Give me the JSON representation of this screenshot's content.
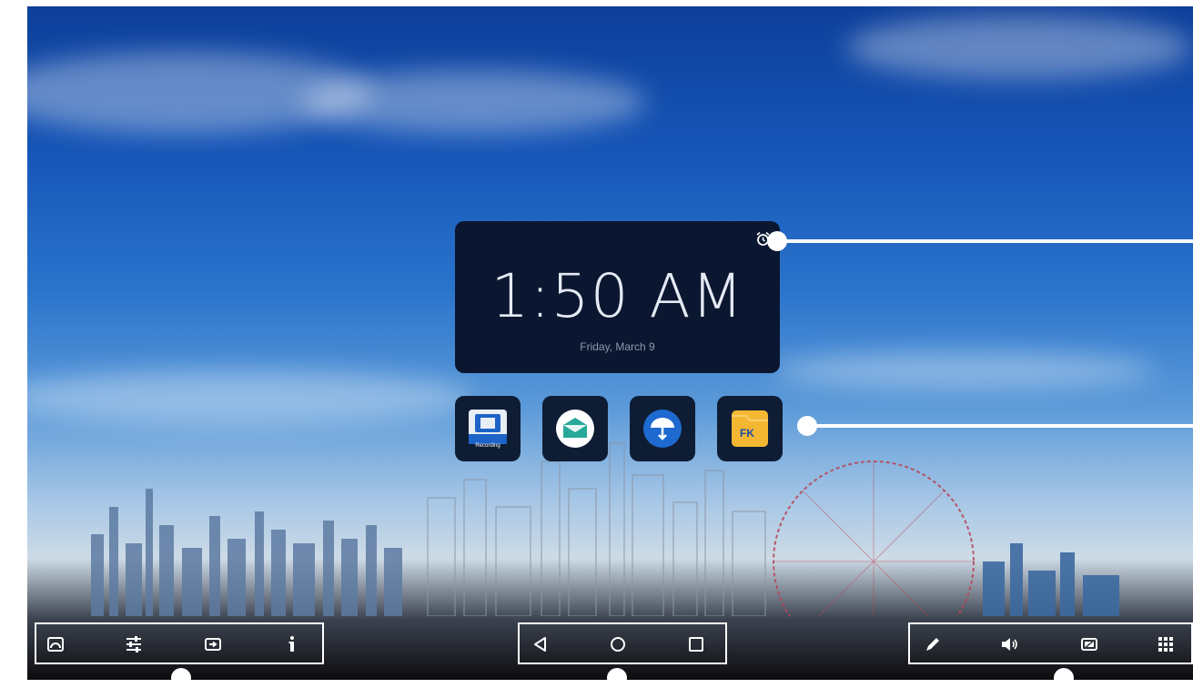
{
  "clock": {
    "time": "1:50 AM",
    "date": "Friday, March 9"
  },
  "apps": [
    {
      "name": "recording",
      "label": "Recording"
    },
    {
      "name": "mail",
      "label": ""
    },
    {
      "name": "cloud",
      "label": ""
    },
    {
      "name": "file-manager",
      "label": ""
    }
  ],
  "left_toolbar": [
    "screen-mirror-icon",
    "sliders-icon",
    "input-source-icon",
    "info-icon"
  ],
  "nav_bar": [
    "back-icon",
    "home-icon",
    "recents-icon"
  ],
  "right_toolbar": [
    "pen-icon",
    "volume-icon",
    "screenshot-icon",
    "app-grid-icon"
  ],
  "colors": {
    "sky_top": "#0d3f9a",
    "card_bg": "#0b1730",
    "folder": "#f4b731",
    "annotation": "#ffffff"
  }
}
